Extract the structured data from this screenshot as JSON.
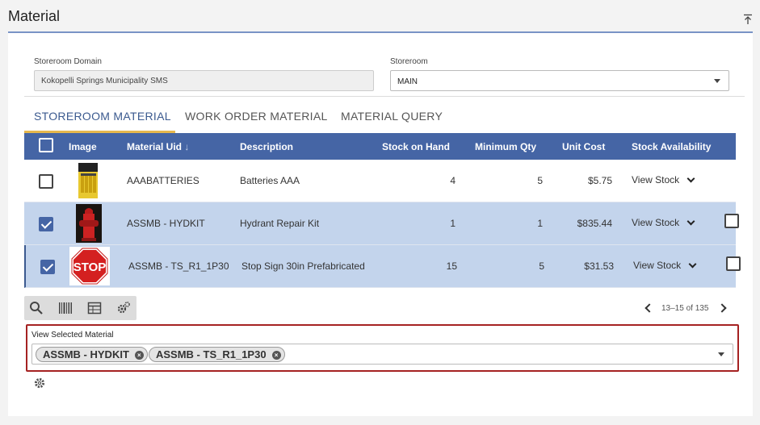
{
  "page": {
    "title": "Material",
    "collapse_icon": "collapse-up-icon"
  },
  "filters": {
    "domain_label": "Storeroom Domain",
    "domain_value": "Kokopelli Springs Municipality SMS",
    "storeroom_label": "Storeroom",
    "storeroom_value": "MAIN"
  },
  "tabs": [
    {
      "label": "STOREROOM MATERIAL",
      "active": true
    },
    {
      "label": "WORK ORDER MATERIAL",
      "active": false
    },
    {
      "label": "MATERIAL QUERY",
      "active": false
    }
  ],
  "table": {
    "columns": [
      "Image",
      "Material Uid",
      "Description",
      "Stock on Hand",
      "Minimum Qty",
      "Unit Cost",
      "Stock Availability"
    ],
    "sort_indicator": "↓",
    "rows": [
      {
        "uid": "AAABATTERIES",
        "description": "Batteries AAA",
        "stock": "4",
        "min": "5",
        "cost": "$5.75",
        "availability": "View Stock",
        "selected": false,
        "image": "batteries-image"
      },
      {
        "uid": "ASSMB - HYDKIT",
        "description": "Hydrant Repair Kit",
        "stock": "1",
        "min": "1",
        "cost": "$835.44",
        "availability": "View Stock",
        "selected": true,
        "image": "hydrant-image"
      },
      {
        "uid": "ASSMB - TS_R1_1P30",
        "description": "Stop Sign 30in Prefabricated",
        "stock": "15",
        "min": "5",
        "cost": "$31.53",
        "availability": "View Stock",
        "selected": true,
        "image": "stop-sign-image",
        "image_text": "STOP"
      }
    ]
  },
  "toolbar": {
    "icons": [
      "search-icon",
      "barcode-icon",
      "table-icon",
      "gears-icon"
    ]
  },
  "pager": {
    "label": "13–15 of 135"
  },
  "selected_material": {
    "label": "View Selected Material",
    "chips": [
      "ASSMB - HYDKIT",
      "ASSMB - TS_R1_1P30"
    ]
  },
  "colors": {
    "header": "#4565a5",
    "selected_row": "#c3d4ec",
    "active_tab_underline": "#e6b84d",
    "highlight_border": "#a52222"
  }
}
